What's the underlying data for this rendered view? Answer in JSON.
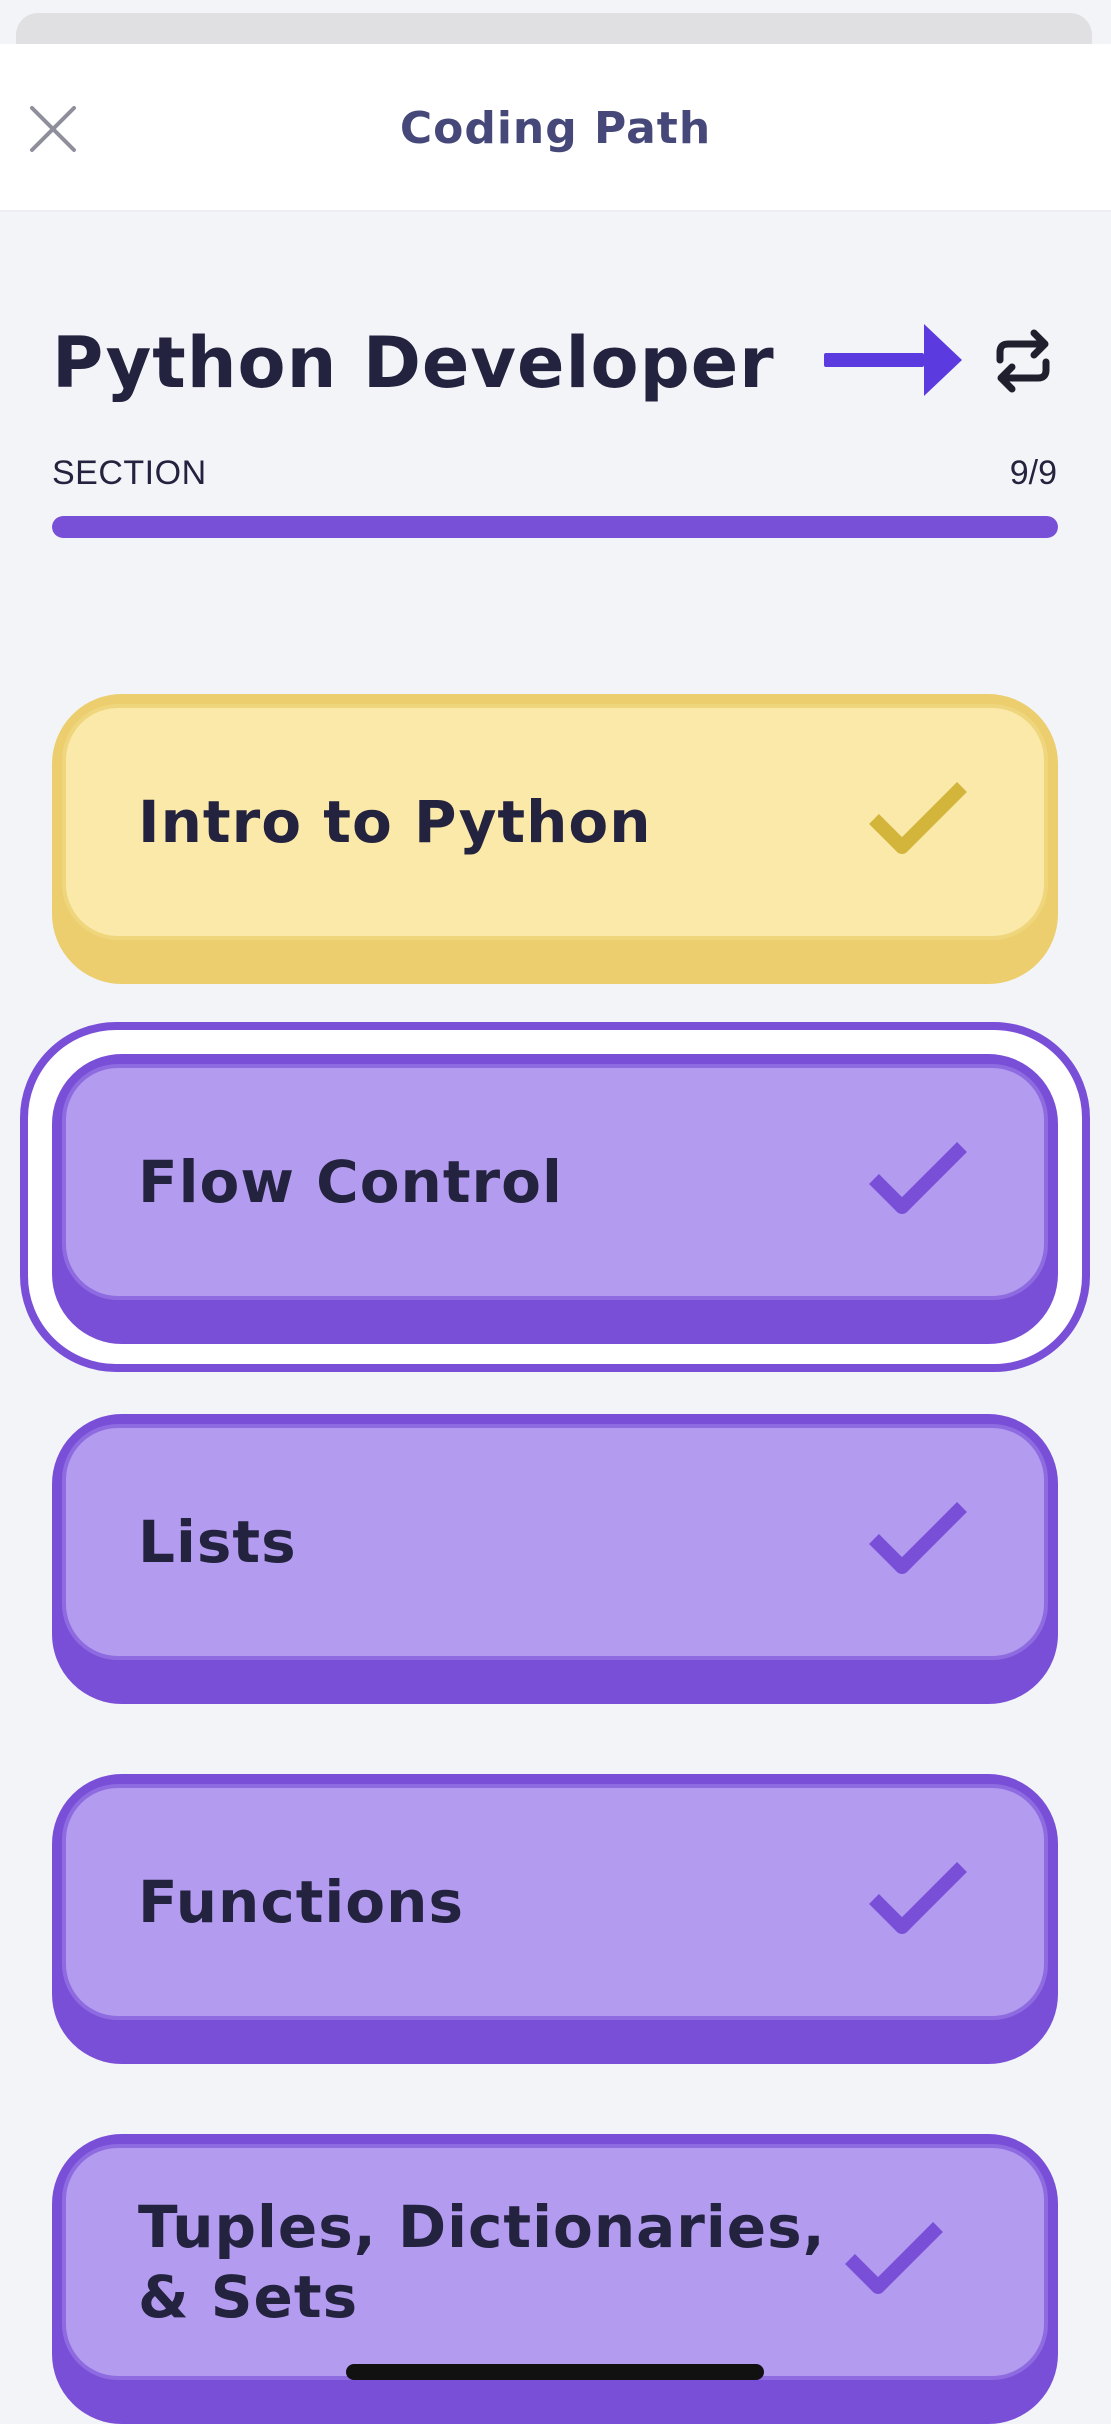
{
  "header": {
    "title": "Coding Path",
    "close_icon": "close-icon"
  },
  "path": {
    "title": "Python Developer",
    "next_icon": "arrow-right-icon",
    "switch_icon": "swap-icon"
  },
  "progress": {
    "section_label": "SECTION",
    "count": "9/9",
    "fraction": 1.0
  },
  "lessons": [
    {
      "label": "Intro to Python",
      "status": "completed"
    },
    {
      "label": "Flow Control",
      "status": "completed"
    },
    {
      "label": "Lists",
      "status": "completed"
    },
    {
      "label": "Functions",
      "status": "completed"
    },
    {
      "label": "Tuples, Dictionaries, & Sets",
      "status": "completed"
    }
  ],
  "colors": {
    "accent_purple": "#7a4fd8",
    "card_purple": "#b39bef",
    "card_yellow": "#fae9a8",
    "check_yellow": "#d4b53c",
    "arrow_blue": "#5b3be0",
    "text_dark": "#24233f"
  }
}
